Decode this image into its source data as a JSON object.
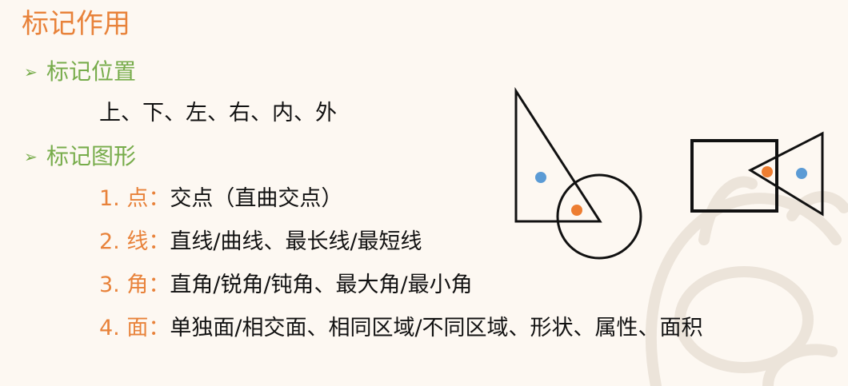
{
  "title": "标记作用",
  "bullets": [
    {
      "marker": "➢",
      "label": "标记位置",
      "content": "上、下、左、右、内、外"
    },
    {
      "marker": "➢",
      "label": "标记图形",
      "items": [
        {
          "num": "1. 点：",
          "text": "交点（直曲交点）"
        },
        {
          "num": "2. 线：",
          "text": "直线/曲线、最长线/最短线"
        },
        {
          "num": "3. 角：",
          "text": "直角/锐角/钝角、最大角/最小角"
        },
        {
          "num": "4. 面：",
          "text": "单独面/相交面、相同区域/不同区域、形状、属性、面积"
        }
      ]
    }
  ],
  "colors": {
    "title": "#e8823a",
    "bullet": "#77ac4b",
    "dot_blue": "#5b9bd5",
    "dot_orange": "#ed7d31",
    "watermark": "#ece2d7"
  }
}
